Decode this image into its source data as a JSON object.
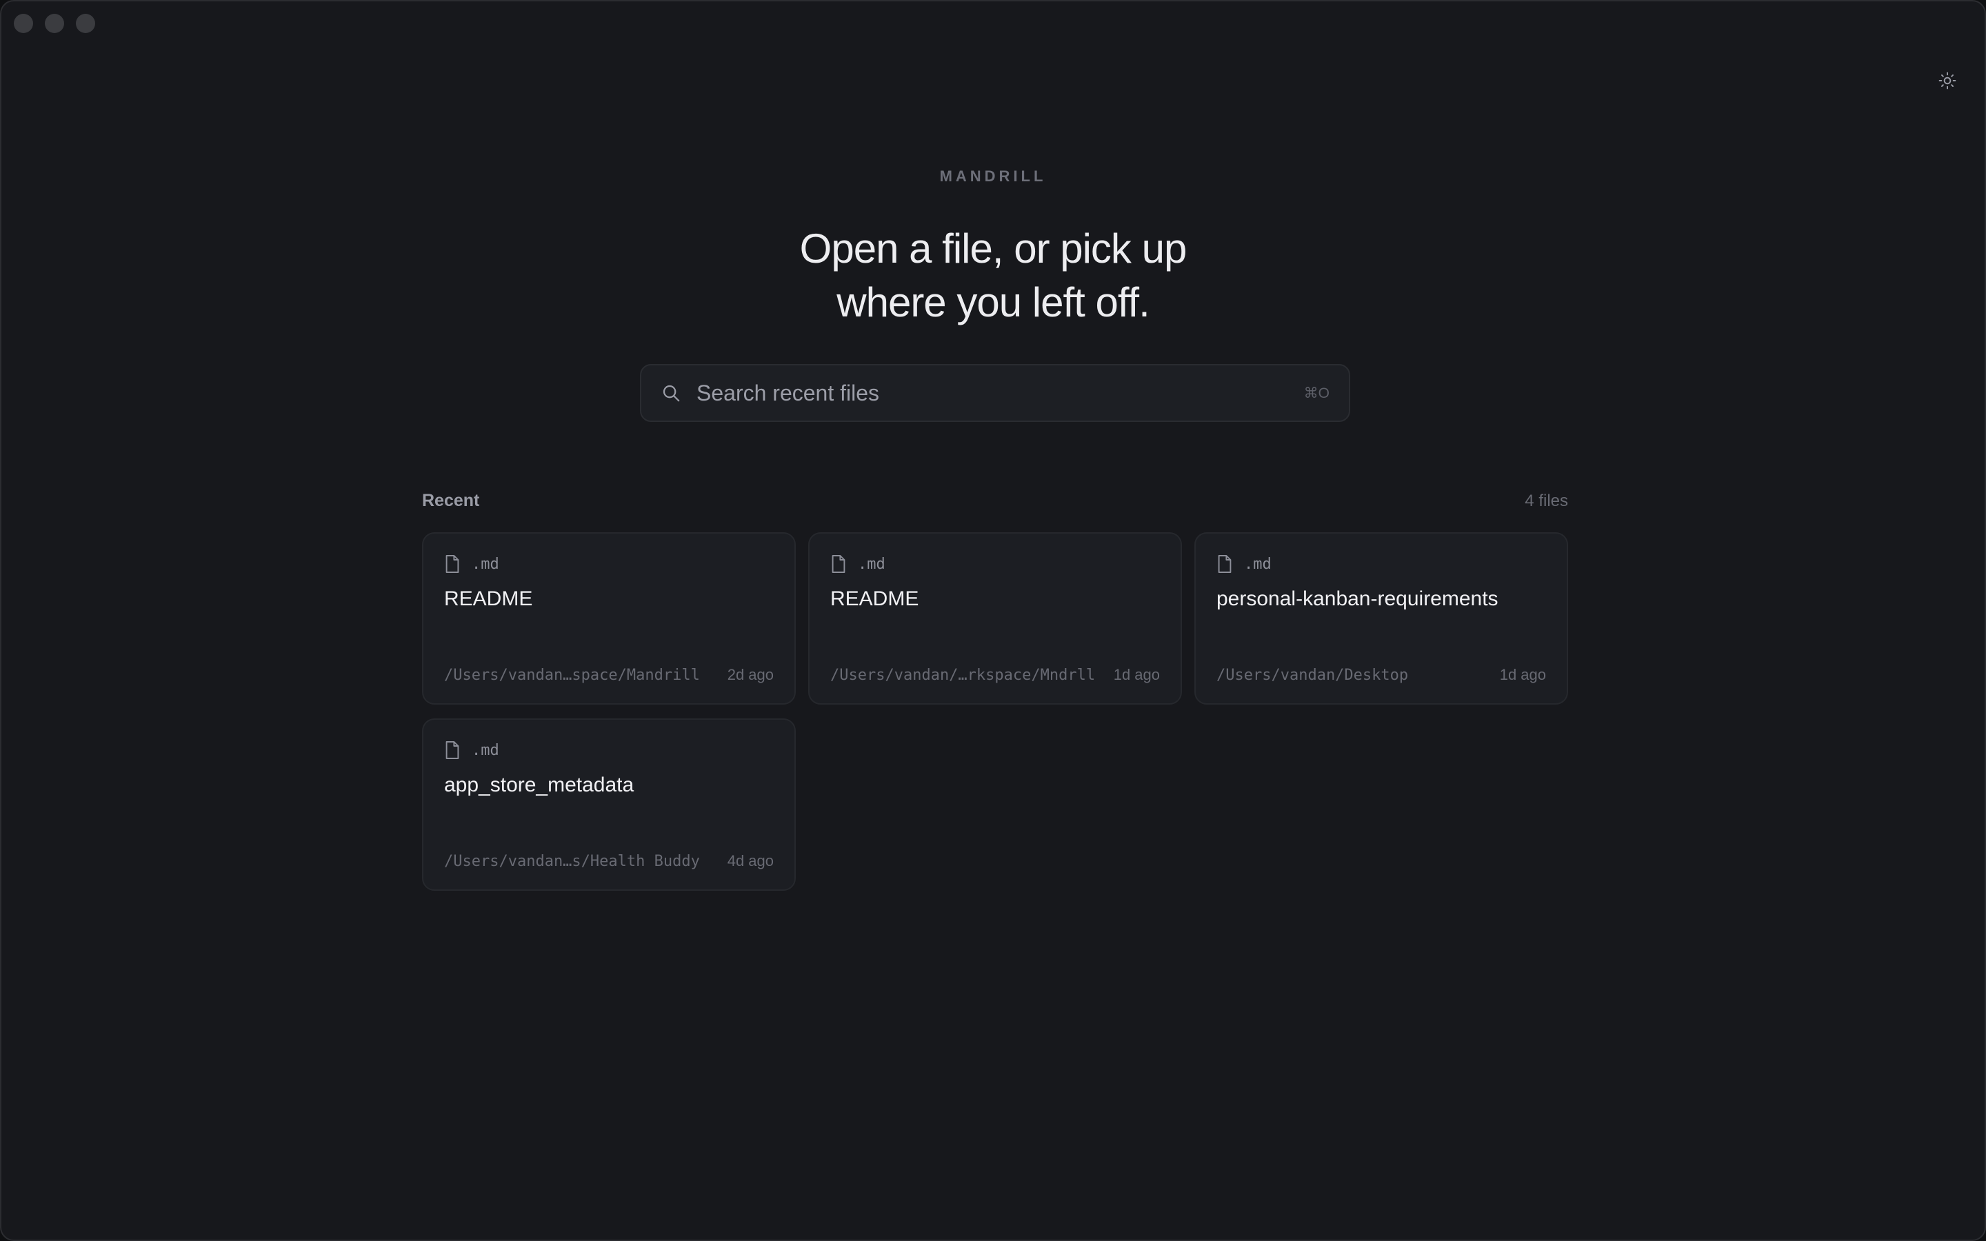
{
  "app": {
    "brand": "MANDRILL"
  },
  "headline": {
    "line1": "Open a file, or pick up",
    "line2": "where you left off."
  },
  "search": {
    "placeholder": "Search recent files",
    "value": "",
    "shortcut": "⌘O"
  },
  "recent": {
    "title": "Recent",
    "count_label": "4 files",
    "files": [
      {
        "ext": ".md",
        "name": "README",
        "path": "/Users/vandan…space/Mandrill",
        "time": "2d ago"
      },
      {
        "ext": ".md",
        "name": "README",
        "path": "/Users/vandan/…rkspace/Mndrll",
        "time": "1d ago"
      },
      {
        "ext": ".md",
        "name": "personal-kanban-requirements",
        "path": "/Users/vandan/Desktop",
        "time": "1d ago"
      },
      {
        "ext": ".md",
        "name": "app_store_metadata",
        "path": "/Users/vandan…s/Health Buddy",
        "time": "4d ago"
      }
    ]
  },
  "icons": {
    "theme_toggle": "sun-icon",
    "search": "search-icon",
    "file": "file-icon"
  },
  "colors": {
    "background": "#17181c",
    "card": "#1c1e23",
    "text_primary": "#ededf0",
    "text_muted": "#686a73"
  }
}
